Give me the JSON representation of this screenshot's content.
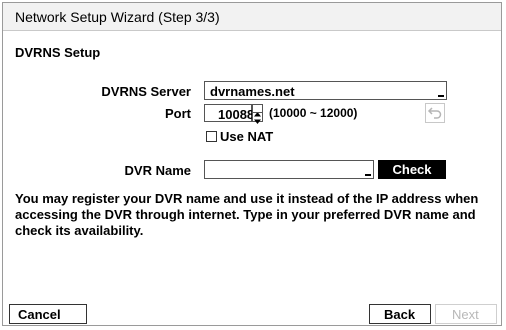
{
  "dialog": {
    "title": "Network Setup Wizard (Step 3/3)",
    "section": "DVRNS Setup"
  },
  "form": {
    "server_label": "DVRNS Server",
    "server_value": "dvrnames.net",
    "port_label": "Port",
    "port_value": "10088",
    "port_range": "(10000 ~ 12000)",
    "use_nat_label": "Use NAT",
    "use_nat_checked": false,
    "dvr_name_label": "DVR Name",
    "dvr_name_value": "",
    "check_label": "Check"
  },
  "description": "You may register your DVR name and use it instead of the IP address when accessing the DVR through internet. Type in your preferred DVR name and check its availability.",
  "buttons": {
    "cancel": "Cancel",
    "back": "Back",
    "next": "Next",
    "next_enabled": false
  },
  "icons": {
    "spinner": "up-down-spinner-icon",
    "undo": "undo-arrow-icon"
  },
  "colors": {
    "title_bar": "#f2f2f2",
    "check_button": "#000000",
    "disabled_text": "#b8b8b8"
  }
}
